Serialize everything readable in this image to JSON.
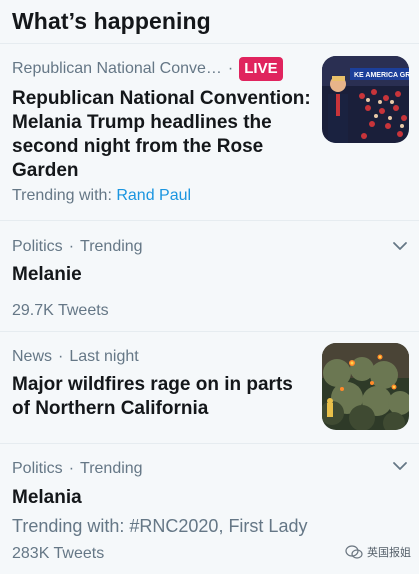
{
  "header": {
    "title": "What’s happening"
  },
  "items": [
    {
      "meta": "Republican National Conve…",
      "live": "LIVE",
      "title": "Republican National Convention: Melania Trump headlines the second night from the Rose Garden",
      "trending_label": "Trending with: ",
      "trending_link": "Rand Paul",
      "image": "rnc-crowd-image"
    },
    {
      "category": "Politics",
      "timing": "Trending",
      "title": "Melanie",
      "count": "29.7K Tweets"
    },
    {
      "category": "News",
      "timing": "Last night",
      "title": "Major wildfires rage on in parts of Northern California",
      "image": "wildfire-image"
    },
    {
      "category": "Politics",
      "timing": "Trending",
      "title": "Melania",
      "trending": "Trending with: #RNC2020, First Lady",
      "count": "283K Tweets"
    }
  ],
  "watermark": {
    "text": "英国报姐"
  },
  "colors": {
    "live": "#e0245e",
    "link": "#1b95e0",
    "muted": "#657786",
    "background": "#f5f8fa"
  }
}
